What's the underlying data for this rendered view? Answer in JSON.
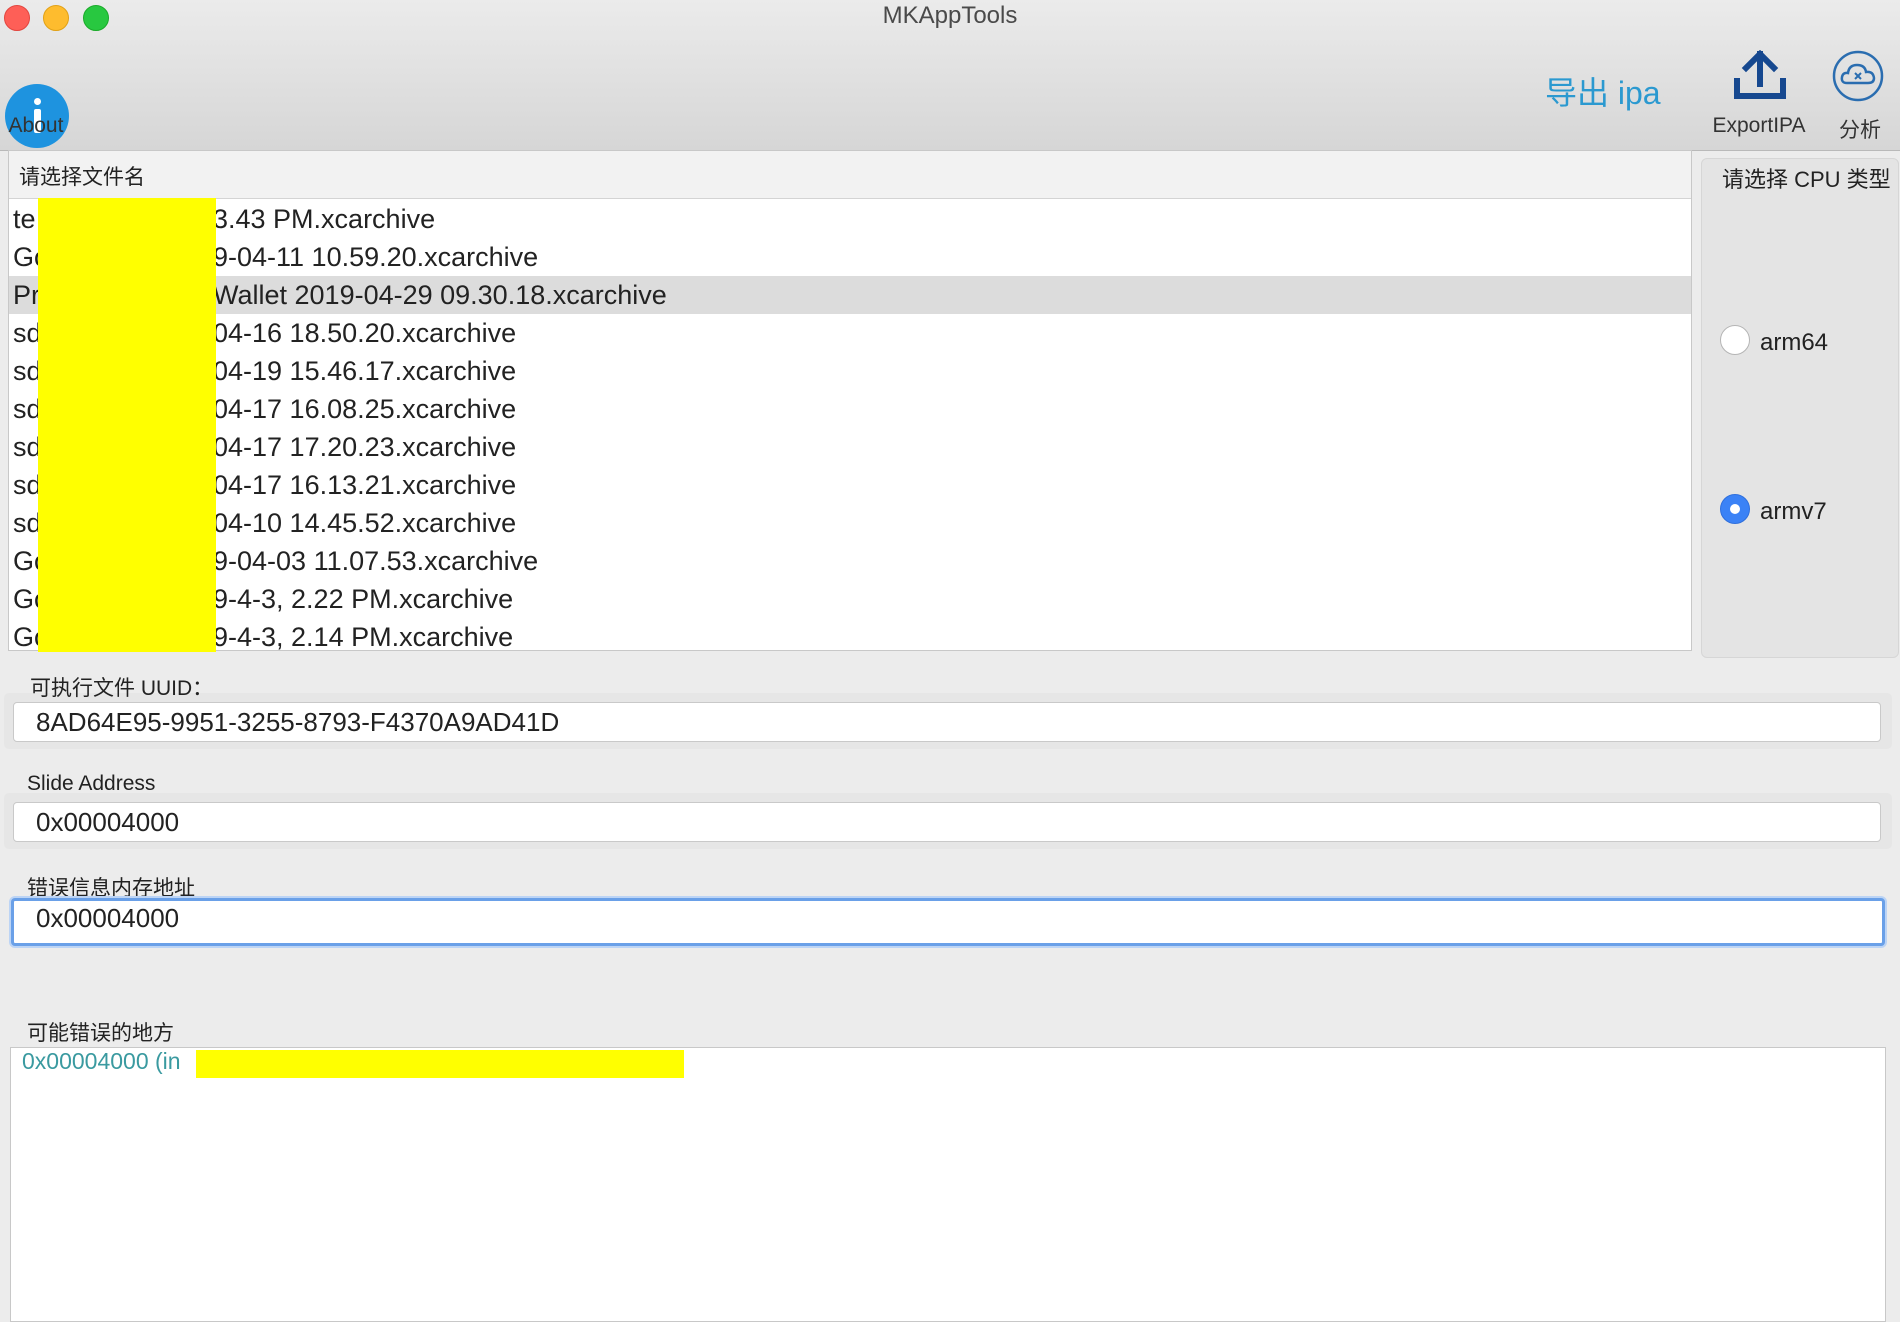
{
  "window": {
    "title": "MKAppTools"
  },
  "toolbar": {
    "about_label": "About",
    "export_link": "导出 ipa",
    "export_ipa_label": "ExportIPA",
    "analyze_label": "分析"
  },
  "colors": {
    "accent": "#2b99d0",
    "about_icon": "#1e93df",
    "radio_selected": "#3b82f6",
    "redaction": "#ffff00",
    "output_text": "#3a9aa0"
  },
  "file_list": {
    "header": "请选择文件名",
    "rows": [
      {
        "prefix": "te",
        "suffix": "3.43 PM.xcarchive",
        "selected": false
      },
      {
        "prefix": "Go",
        "suffix": "9-04-11 10.59.20.xcarchive",
        "selected": false
      },
      {
        "prefix": "Pr",
        "suffix": "Wallet 2019-04-29 09.30.18.xcarchive",
        "selected": true
      },
      {
        "prefix": "sd",
        "suffix": "04-16 18.50.20.xcarchive",
        "selected": false
      },
      {
        "prefix": "sd",
        "suffix": "04-19 15.46.17.xcarchive",
        "selected": false
      },
      {
        "prefix": "sd",
        "suffix": "04-17 16.08.25.xcarchive",
        "selected": false
      },
      {
        "prefix": "sd",
        "suffix": "04-17 17.20.23.xcarchive",
        "selected": false
      },
      {
        "prefix": "sd",
        "suffix": "04-17 16.13.21.xcarchive",
        "selected": false
      },
      {
        "prefix": "sd",
        "suffix": "04-10 14.45.52.xcarchive",
        "selected": false
      },
      {
        "prefix": "Go",
        "suffix": "9-04-03 11.07.53.xcarchive",
        "selected": false
      },
      {
        "prefix": "Go",
        "suffix": "9-4-3, 2.22 PM.xcarchive",
        "selected": false
      },
      {
        "prefix": "Go",
        "suffix": "9-4-3, 2.14 PM.xcarchive",
        "selected": false
      }
    ]
  },
  "cpu": {
    "title": "请选择 CPU 类型",
    "options": [
      {
        "label": "arm64",
        "selected": false
      },
      {
        "label": "armv7",
        "selected": true
      }
    ]
  },
  "uuid": {
    "label": "可执行文件 UUID：",
    "value": "8AD64E95-9951-3255-8793-F4370A9AD41D"
  },
  "slide": {
    "label": "Slide Address",
    "value": "0x00004000"
  },
  "error_address": {
    "label": "错误信息内存地址",
    "value": "0x00004000"
  },
  "output": {
    "label": "可能错误的地方",
    "text": "0x00004000 (in "
  }
}
